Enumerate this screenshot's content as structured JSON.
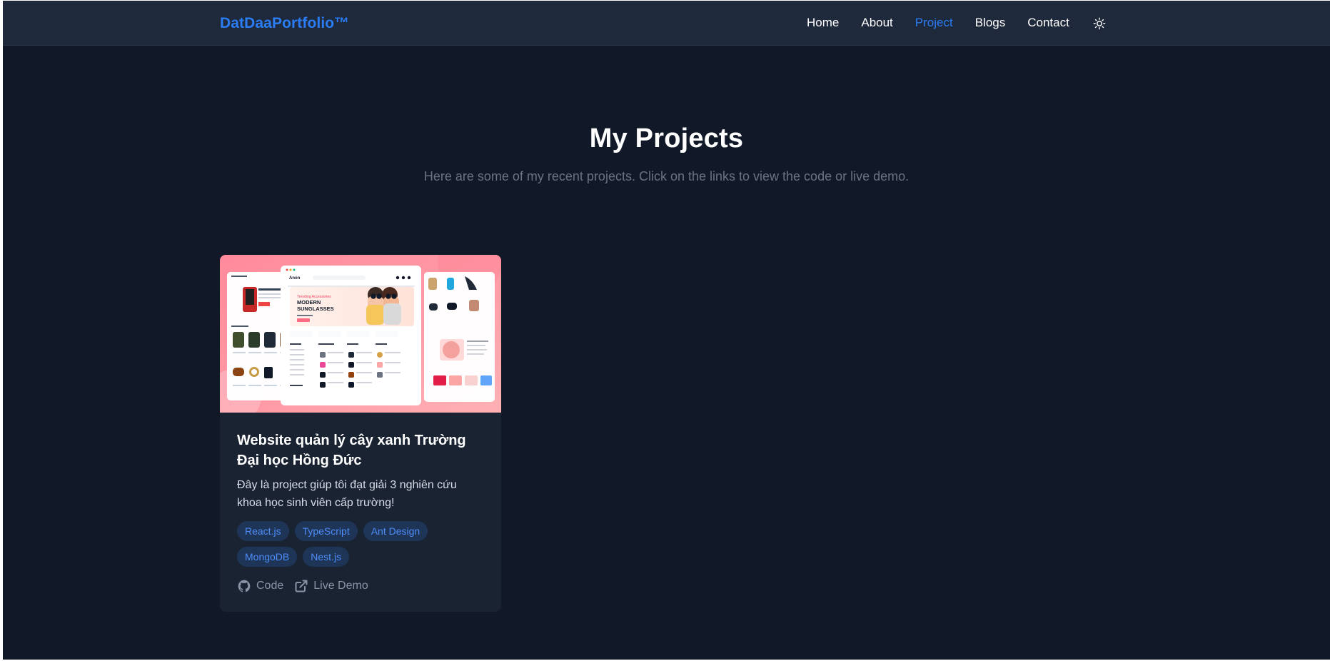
{
  "header": {
    "brand": "DatDaaPortfolio™",
    "nav": [
      {
        "label": "Home",
        "active": false
      },
      {
        "label": "About",
        "active": false
      },
      {
        "label": "Project",
        "active": true
      },
      {
        "label": "Blogs",
        "active": false
      },
      {
        "label": "Contact",
        "active": false
      }
    ],
    "theme_toggle_icon": "sun-icon"
  },
  "hero": {
    "title": "My Projects",
    "subtitle": "Here are some of my recent projects. Click on the links to view the code or live demo."
  },
  "projects": [
    {
      "title": "Website quản lý cây xanh Trường Đại học Hồng Đức",
      "description": "Đây là project giúp tôi đạt giải 3 nghiên cứu khoa học sinh viên cấp trường!",
      "tags": [
        "React.js",
        "TypeScript",
        "Ant Design",
        "MongoDB",
        "Nest.js"
      ],
      "links": [
        {
          "label": "Code",
          "icon": "github-icon"
        },
        {
          "label": "Live Demo",
          "icon": "external-link-icon"
        }
      ],
      "image": {
        "banner_kicker": "Trending Accessories",
        "banner_title_line1": "MODERN",
        "banner_title_line2": "SUNGLASSES",
        "store_name": "Anon"
      }
    }
  ],
  "colors": {
    "background": "#111827",
    "navbar": "#1e293b",
    "card": "#1a2332",
    "accent": "#2b7df6",
    "muted": "#6b7280",
    "tag_bg": "#1f3558"
  }
}
